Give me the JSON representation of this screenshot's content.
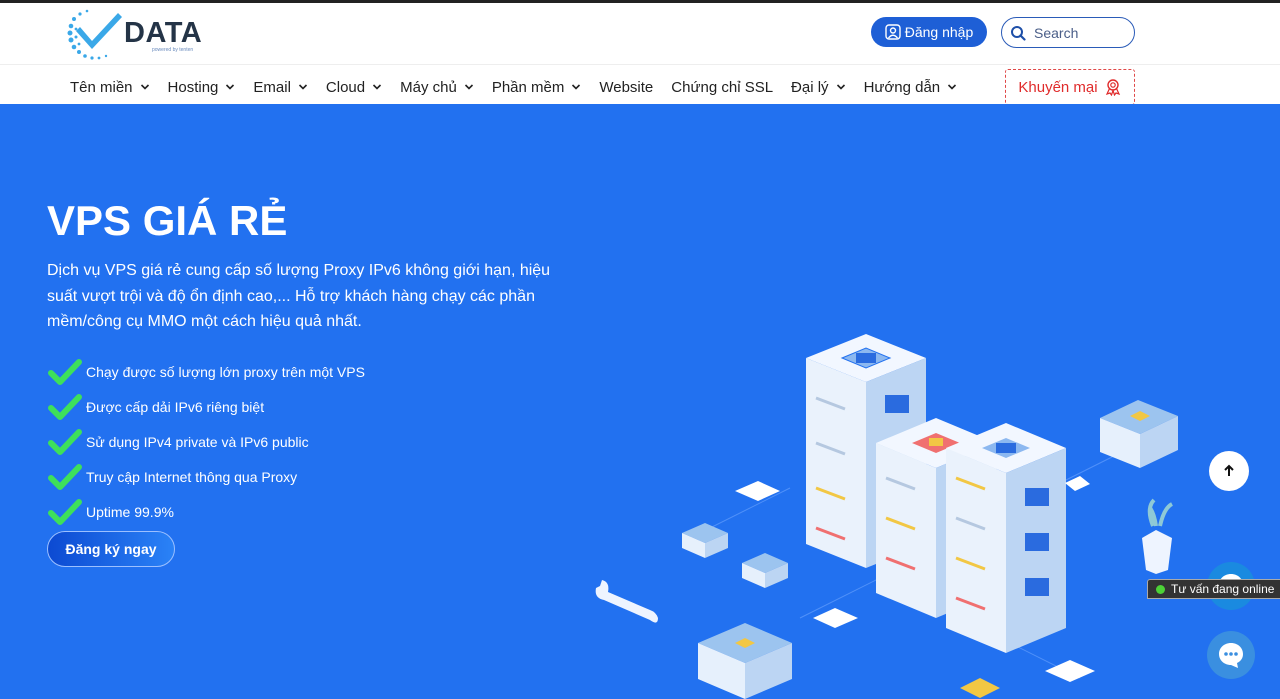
{
  "header": {
    "logo_text": "DATA",
    "logo_sub": "powered by tenten",
    "login_label": "Đăng nhập",
    "search_placeholder": "Search"
  },
  "nav": {
    "items": [
      {
        "label": "Tên miền",
        "dropdown": true
      },
      {
        "label": "Hosting",
        "dropdown": true
      },
      {
        "label": "Email",
        "dropdown": true
      },
      {
        "label": "Cloud",
        "dropdown": true
      },
      {
        "label": "Máy chủ",
        "dropdown": true
      },
      {
        "label": "Phần mềm",
        "dropdown": true
      },
      {
        "label": "Website",
        "dropdown": false
      },
      {
        "label": "Chứng chỉ SSL",
        "dropdown": false
      },
      {
        "label": "Đại lý",
        "dropdown": true
      },
      {
        "label": "Hướng dẫn",
        "dropdown": true
      }
    ],
    "promo_label": "Khuyến mại"
  },
  "hero": {
    "title": "VPS GIÁ RẺ",
    "description": "Dịch vụ VPS giá rẻ  cung cấp số lượng Proxy IPv6 không giới hạn, hiệu suất vượt trội và độ ổn định cao,... Hỗ trợ khách hàng chạy các phần mềm/công cụ MMO một cách hiệu quả nhất.",
    "features": [
      "Chạy được số lượng lớn proxy trên một VPS",
      "Được cấp dải IPv6 riêng biệt",
      "Sử dụng IPv4 private và IPv6 public",
      "Truy cập Internet thông qua Proxy",
      "Uptime 99.9%"
    ],
    "cta_label": "Đăng ký ngay"
  },
  "widgets": {
    "online_status": "Tư vấn đang online"
  },
  "colors": {
    "hero_bg": "#2271f0",
    "brand_blue": "#1e5fd6",
    "promo_red": "#e02b2b",
    "check_green": "#3ee05a"
  }
}
